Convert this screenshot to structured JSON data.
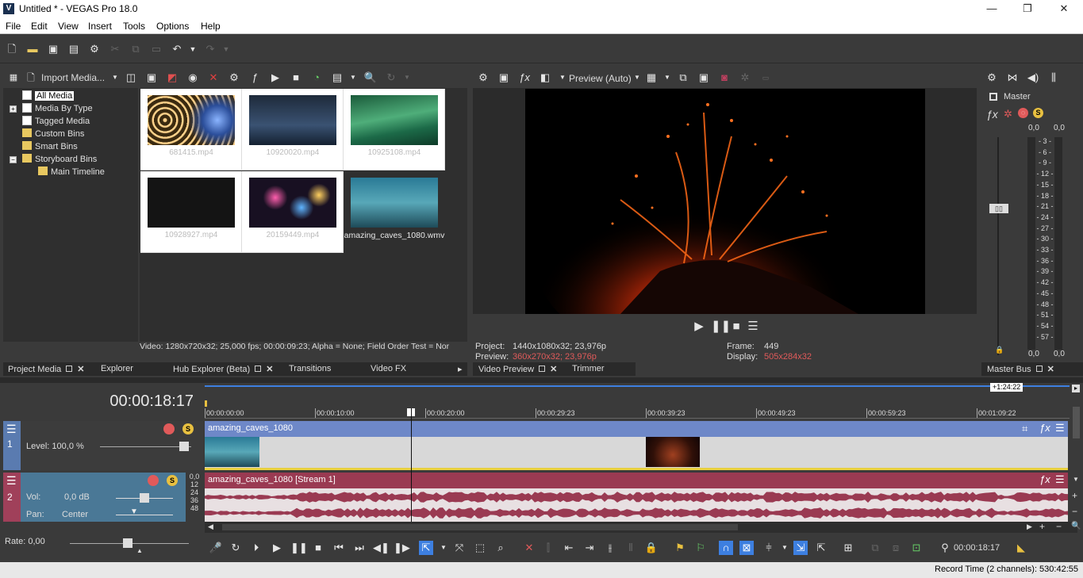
{
  "window": {
    "title": "Untitled * - VEGAS Pro 18.0",
    "logo": "V",
    "min": "—",
    "max": "❐",
    "close": "✕"
  },
  "menu": [
    "File",
    "Edit",
    "View",
    "Insert",
    "Tools",
    "Options",
    "Help"
  ],
  "project_media": {
    "import_label": "Import Media...",
    "tree": [
      {
        "label": "All Media",
        "type": "page",
        "indent": 0,
        "selected": true
      },
      {
        "label": "Media By Type",
        "type": "page",
        "indent": 0,
        "expander": "+"
      },
      {
        "label": "Tagged Media",
        "type": "page",
        "indent": 0
      },
      {
        "label": "Custom Bins",
        "type": "folder",
        "indent": 0
      },
      {
        "label": "Smart Bins",
        "type": "folder",
        "indent": 0
      },
      {
        "label": "Storyboard Bins",
        "type": "folder",
        "indent": 0,
        "expander": "−"
      },
      {
        "label": "Main Timeline",
        "type": "folder",
        "indent": 1
      }
    ],
    "thumbnails": [
      {
        "name": "681415.mp4",
        "watermark": "videohive"
      },
      {
        "name": "10920020.mp4",
        "watermark": "videohive"
      },
      {
        "name": "10925108.mp4",
        "watermark": "videohive"
      },
      {
        "name": "10928927.mp4",
        "watermark": "videohive"
      },
      {
        "name": "20159449.mp4",
        "watermark": "videohive"
      },
      {
        "name": "amazing_caves_1080.wmv",
        "watermark": ""
      }
    ],
    "info": "Video: 1280x720x32; 25,000 fps; 00:00:09:23; Alpha = None; Field Order Test = Nor"
  },
  "left_tabs": [
    "Project Media",
    "Explorer",
    "Hub Explorer (Beta)",
    "Transitions",
    "Video FX"
  ],
  "preview": {
    "mode": "Preview (Auto)",
    "project_label": "Project:",
    "project_value": "1440x1080x32; 23,976p",
    "preview_label": "Preview:",
    "preview_value": "360x270x32; 23,976p",
    "frame_label": "Frame:",
    "frame_value": "449",
    "display_label": "Display:",
    "display_value": "505x284x32",
    "tabs": [
      "Video Preview",
      "Trimmer"
    ]
  },
  "master_bus": {
    "label": "Master",
    "left_top": "0,0",
    "right_top": "0,0",
    "left_bottom": "0,0",
    "right_bottom": "0,0",
    "scale": [
      "3",
      "6",
      "9",
      "12",
      "15",
      "18",
      "21",
      "24",
      "27",
      "30",
      "33",
      "36",
      "39",
      "42",
      "45",
      "48",
      "51",
      "54",
      "57"
    ],
    "tab": "Master Bus"
  },
  "timeline": {
    "timecode": "00:00:18:17",
    "length_badge": "+1:24:22",
    "ruler": [
      "00:00:00:00",
      "00:00:10:00",
      "00:00:20:00",
      "00:00:29:23",
      "00:00:39:23",
      "00:00:49:23",
      "00:00:59:23",
      "00:01:09:22"
    ],
    "track1": {
      "number": "1",
      "level_label": "Level: 100,0 %",
      "clip": "amazing_caves_1080"
    },
    "track2": {
      "number": "2",
      "vol_label": "Vol:",
      "vol_value": "0,0 dB",
      "pan_label": "Pan:",
      "pan_value": "Center",
      "peak": "0,0",
      "clip": "amazing_caves_1080 [Stream 1]",
      "meter": [
        "12",
        "24",
        "36",
        "48"
      ]
    },
    "rate": "Rate: 0,00",
    "cursor_time": "00:00:18:17"
  },
  "status": "Record Time (2 channels): 530:42:55"
}
